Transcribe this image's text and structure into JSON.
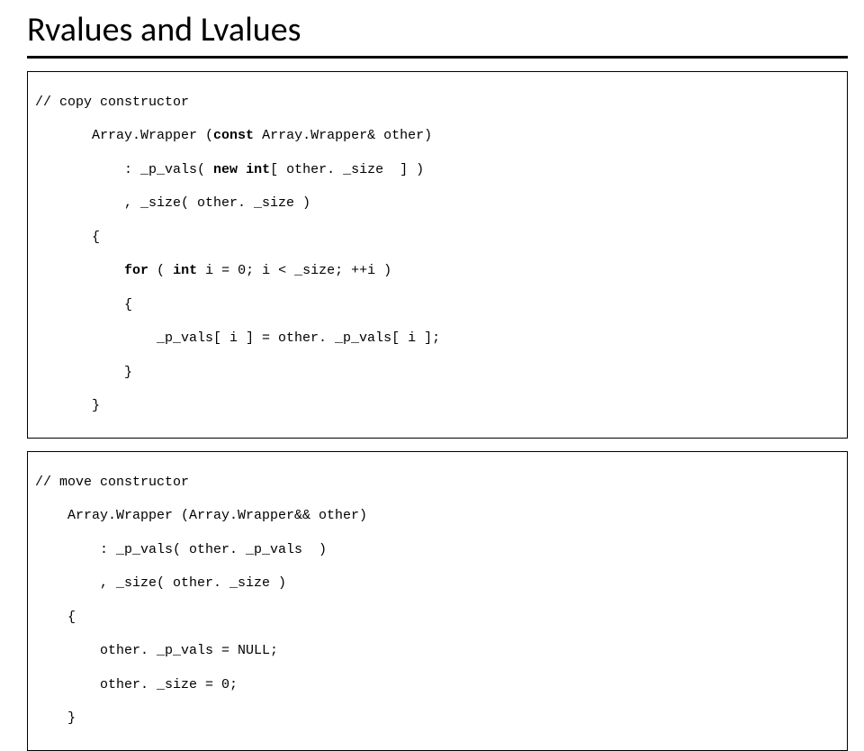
{
  "title": "Rvalues and Lvalues",
  "box1": {
    "l1": "// copy constructor",
    "l2_pre": "       Array.Wrapper (",
    "l2_kw": "const",
    "l2_post": " Array.Wrapper& other)",
    "l3_pre": "           : _p_vals( ",
    "l3_kw1": "new",
    "l3_mid": " ",
    "l3_kw2": "int",
    "l3_post": "[ other. _size  ] )",
    "l4": "           , _size( other. _size )",
    "l5": "       {",
    "l6_pre": "           ",
    "l6_kw1": "for",
    "l6_mid1": " ( ",
    "l6_kw2": "int",
    "l6_post": " i = 0; i < _size; ++i )",
    "l7": "           {",
    "l8": "               _p_vals[ i ] = other. _p_vals[ i ];",
    "l9": "           }",
    "l10": "       }"
  },
  "box2": {
    "l1": "// move constructor",
    "l2": "    Array.Wrapper (Array.Wrapper&& other)",
    "l3": "        : _p_vals( other. _p_vals  )",
    "l4": "        , _size( other. _size )",
    "l5": "    {",
    "l6": "        other. _p_vals = NULL;",
    "l7": "        other. _size = 0;",
    "l8": "    }"
  }
}
